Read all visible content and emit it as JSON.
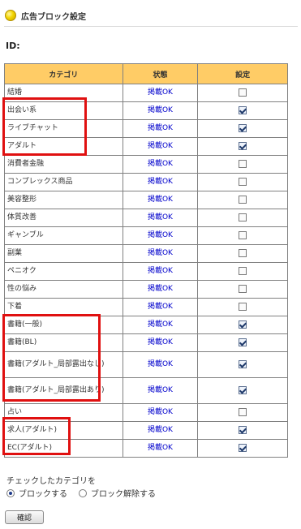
{
  "header": {
    "title": "広告ブロック設定"
  },
  "id_label": "ID:",
  "table": {
    "columns": [
      "カテゴリ",
      "状態",
      "設定"
    ],
    "rows": [
      {
        "category": "結婚",
        "status": "掲載OK",
        "checked": false
      },
      {
        "category": "出会い系",
        "status": "掲載OK",
        "checked": true
      },
      {
        "category": "ライブチャット",
        "status": "掲載OK",
        "checked": true
      },
      {
        "category": "アダルト",
        "status": "掲載OK",
        "checked": true
      },
      {
        "category": "消費者金融",
        "status": "掲載OK",
        "checked": false
      },
      {
        "category": "コンプレックス商品",
        "status": "掲載OK",
        "checked": false
      },
      {
        "category": "美容整形",
        "status": "掲載OK",
        "checked": false
      },
      {
        "category": "体質改善",
        "status": "掲載OK",
        "checked": false
      },
      {
        "category": "ギャンブル",
        "status": "掲載OK",
        "checked": false
      },
      {
        "category": "副業",
        "status": "掲載OK",
        "checked": false
      },
      {
        "category": "ペニオク",
        "status": "掲載OK",
        "checked": false
      },
      {
        "category": "性の悩み",
        "status": "掲載OK",
        "checked": false
      },
      {
        "category": "下着",
        "status": "掲載OK",
        "checked": false
      },
      {
        "category": "書籍(一般)",
        "status": "掲載OK",
        "checked": true
      },
      {
        "category": "書籍(BL)",
        "status": "掲載OK",
        "checked": true
      },
      {
        "category": "書籍(アダルト_局部露出なし)",
        "status": "掲載OK",
        "checked": true
      },
      {
        "category": "書籍(アダルト_局部露出あり)",
        "status": "掲載OK",
        "checked": true
      },
      {
        "category": "占い",
        "status": "掲載OK",
        "checked": false
      },
      {
        "category": "求人(アダルト)",
        "status": "掲載OK",
        "checked": true
      },
      {
        "category": "EC(アダルト)",
        "status": "掲載OK",
        "checked": true
      }
    ]
  },
  "footer": {
    "instruction": "チェックしたカテゴリを",
    "options": [
      {
        "label": "ブロックする",
        "selected": true
      },
      {
        "label": "ブロック解除する",
        "selected": false
      }
    ],
    "confirm_label": "確認"
  },
  "colors": {
    "header_bg": "#ffcc66",
    "highlight": "#e01010",
    "link": "#0000cc"
  }
}
